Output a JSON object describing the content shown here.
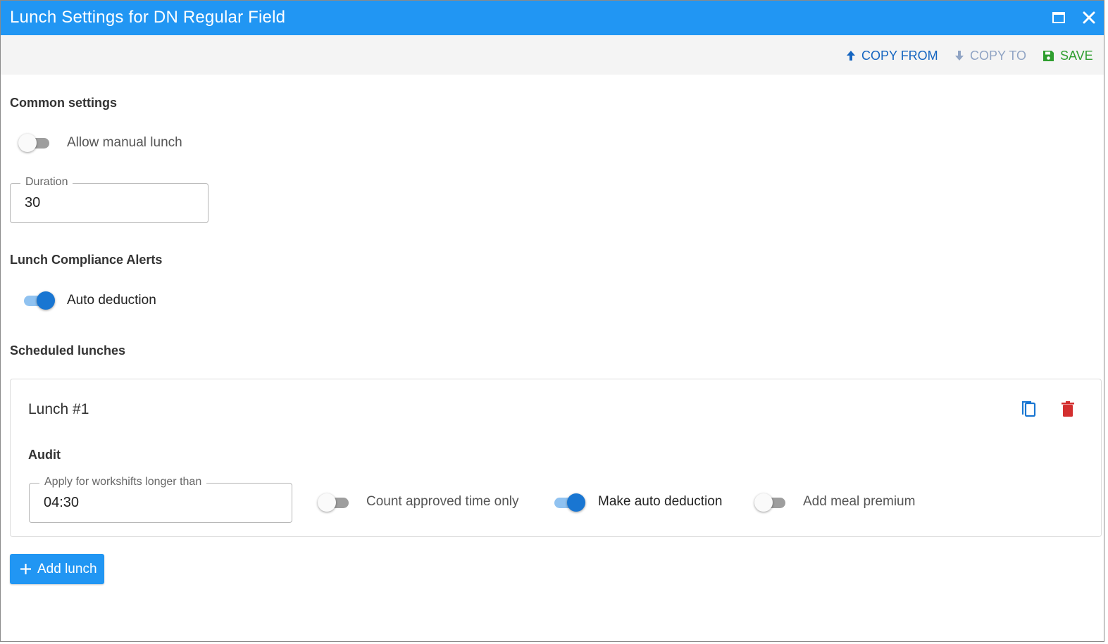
{
  "window": {
    "title": "Lunch Settings for DN Regular Field",
    "maximize_icon": "maximize-icon",
    "close_icon": "close-icon"
  },
  "toolbar": {
    "copy_from_label": "COPY FROM",
    "copy_to_label": "COPY TO",
    "save_label": "SAVE",
    "copy_to_disabled": true
  },
  "common_settings": {
    "heading": "Common settings",
    "allow_manual_lunch": {
      "label": "Allow manual lunch",
      "on": false
    },
    "duration": {
      "label": "Duration",
      "value": "30"
    }
  },
  "compliance": {
    "heading": "Lunch Compliance Alerts",
    "auto_deduction": {
      "label": "Auto deduction",
      "on": true
    }
  },
  "scheduled": {
    "heading": "Scheduled lunches",
    "lunches": [
      {
        "title": "Lunch #1",
        "audit_heading": "Audit",
        "apply_field": {
          "label": "Apply for workshifts longer than",
          "value": "04:30"
        },
        "count_approved": {
          "label": "Count approved time only",
          "on": false
        },
        "make_auto_deduction": {
          "label": "Make auto deduction",
          "on": true
        },
        "add_meal_premium": {
          "label": "Add meal premium",
          "on": false
        }
      }
    ],
    "add_label": "Add lunch"
  },
  "colors": {
    "titlebar": "#2196f3",
    "primary": "#1976d2",
    "save": "#2e9e2e",
    "delete": "#d32f2f",
    "disabled": "#90a4c4"
  }
}
